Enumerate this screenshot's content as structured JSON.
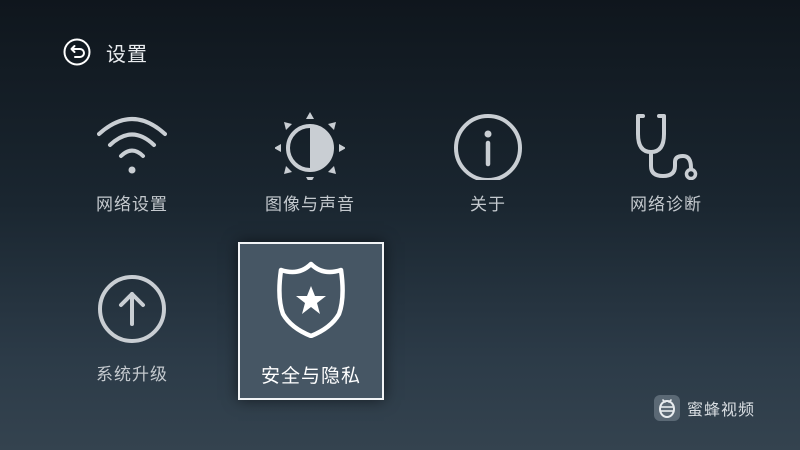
{
  "header": {
    "title": "设置",
    "back_icon": "back-arrow-icon"
  },
  "tiles": [
    {
      "label": "网络设置",
      "icon": "wifi-icon"
    },
    {
      "label": "图像与声音",
      "icon": "brightness-icon"
    },
    {
      "label": "关于",
      "icon": "info-icon"
    },
    {
      "label": "网络诊断",
      "icon": "stethoscope-icon"
    },
    {
      "label": "系统升级",
      "icon": "upgrade-arrow-icon"
    },
    {
      "label": "安全与隐私",
      "icon": "shield-star-icon",
      "focused": true
    }
  ],
  "brand": {
    "name": "蜜蜂视频",
    "icon": "bee-logo-icon"
  },
  "colors": {
    "icon_stroke": "#c9ced3",
    "focused_background": "#465664",
    "focused_border": "#f2f4f6"
  }
}
